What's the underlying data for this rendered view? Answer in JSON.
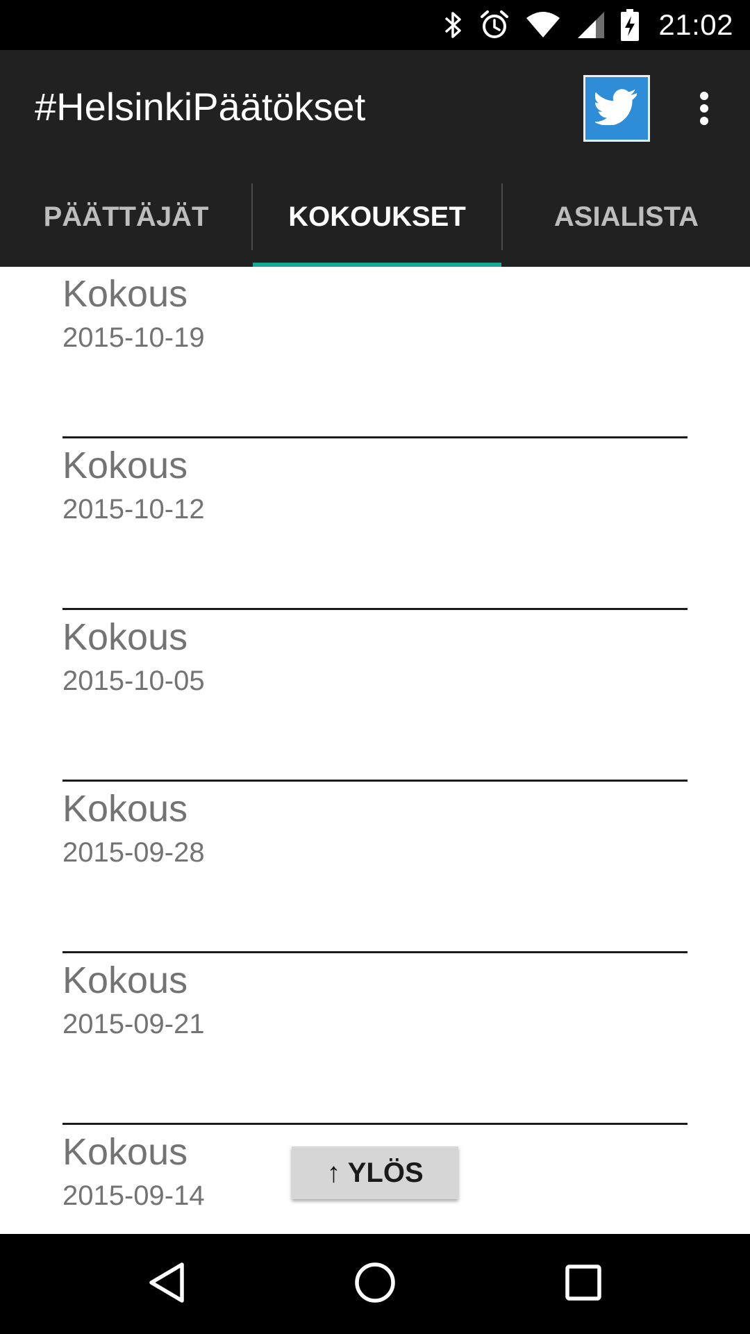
{
  "status_bar": {
    "time": "21:02",
    "icons": [
      "bluetooth-icon",
      "alarm-icon",
      "wifi-icon",
      "cell-signal-icon",
      "battery-charging-icon"
    ]
  },
  "app_bar": {
    "title": "#HelsinkiPäätökset",
    "twitter_icon": "twitter-bird-icon",
    "overflow_icon": "overflow-menu-icon"
  },
  "tabs": [
    {
      "label": "PÄÄTTÄJÄT",
      "active": false
    },
    {
      "label": "KOKOUKSET",
      "active": true
    },
    {
      "label": "ASIALISTA",
      "active": false
    }
  ],
  "meetings": [
    {
      "title": "Kokous",
      "date": "2015-10-19"
    },
    {
      "title": "Kokous",
      "date": "2015-10-12"
    },
    {
      "title": "Kokous",
      "date": "2015-10-05"
    },
    {
      "title": "Kokous",
      "date": "2015-09-28"
    },
    {
      "title": "Kokous",
      "date": "2015-09-21"
    },
    {
      "title": "Kokous",
      "date": "2015-09-14"
    }
  ],
  "up_button": {
    "label": "↑ YLÖS"
  },
  "colors": {
    "app_bar": "#212121",
    "tab_indicator": "#1ba896",
    "twitter_blue": "#2f8dd8",
    "list_text": "#737373"
  },
  "nav_bar": {
    "back_icon": "back-triangle-icon",
    "home_icon": "home-circle-icon",
    "recents_icon": "recents-square-icon"
  }
}
